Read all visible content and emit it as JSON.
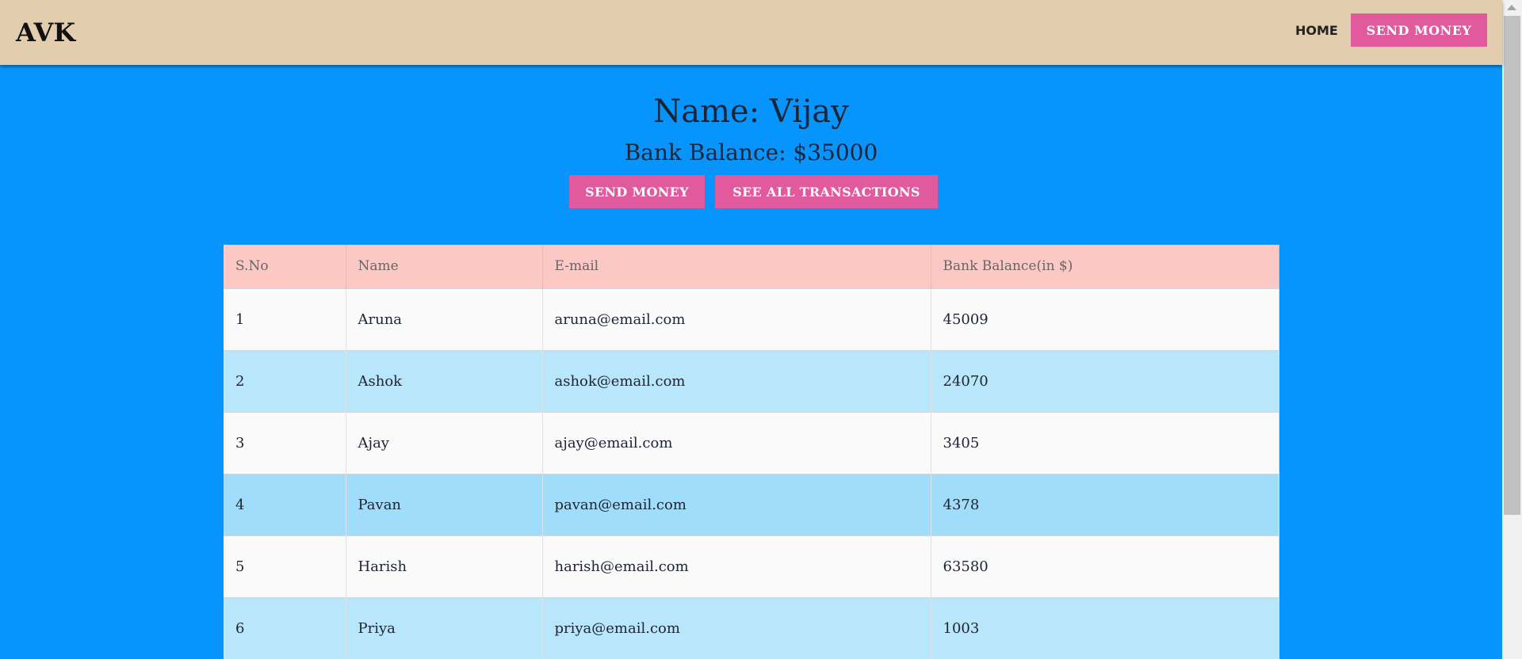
{
  "navbar": {
    "logo": "AVK",
    "home_label": "HOME",
    "send_money_label": "SEND MONEY"
  },
  "profile": {
    "name_line": "Name: Vijay",
    "balance_line": "Bank Balance: $35000"
  },
  "actions": {
    "send_money_label": "SEND MONEY",
    "see_transactions_label": "SEE ALL TRANSACTIONS"
  },
  "table": {
    "headers": [
      "S.No",
      "Name",
      "E-mail",
      "Bank Balance(in $)"
    ],
    "rows": [
      [
        "1",
        "Aruna",
        "aruna@email.com",
        "45009"
      ],
      [
        "2",
        "Ashok",
        "ashok@email.com",
        "24070"
      ],
      [
        "3",
        "Ajay",
        "ajay@email.com",
        "3405"
      ],
      [
        "4",
        "Pavan",
        "pavan@email.com",
        "4378"
      ],
      [
        "5",
        "Harish",
        "harish@email.com",
        "63580"
      ],
      [
        "6",
        "Priya",
        "priya@email.com",
        "1003"
      ]
    ]
  },
  "colors": {
    "page_background": "#0894fd",
    "navbar_background": "#e2cdaf",
    "button_pink": "#e05a9d",
    "header_row": "#fbc8c4",
    "row_light": "#fafafa",
    "row_blue": "#b8e6fa"
  }
}
